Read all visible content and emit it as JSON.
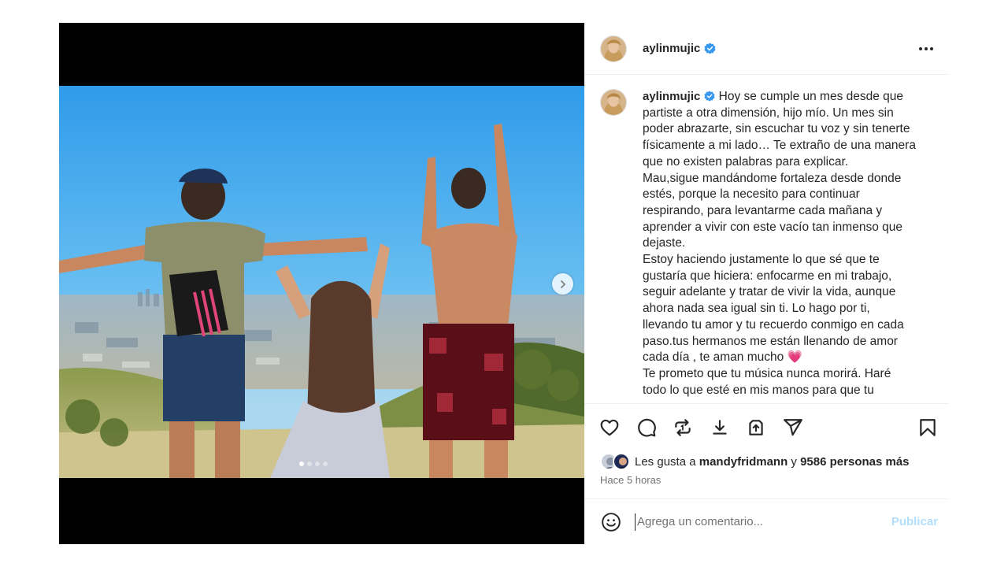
{
  "post": {
    "username": "aylinmujic",
    "verified": true,
    "media": {
      "slide_count": 4,
      "active_slide": 1,
      "next_icon": "chevron-right-icon"
    },
    "caption": {
      "lines": [
        "Hoy se cumple un mes desde que",
        "partiste a otra dimensión, hijo mío. Un mes sin",
        "poder abrazarte, sin escuchar tu voz y sin tenerte",
        "físicamente a mi lado… Te extraño de una manera",
        "que no existen palabras para explicar.",
        "Mau,sigue mandándome fortaleza desde donde",
        "estés, porque la necesito para continuar",
        "respirando, para levantarme cada mañana y",
        "aprender a vivir con este vacío tan inmenso que",
        "dejaste.",
        "Estoy haciendo justamente lo que sé que te",
        "gustaría que hiciera: enfocarme en mi trabajo,",
        "seguir adelante y tratar de vivir la vida, aunque",
        "ahora nada sea igual sin ti. Lo hago por ti,",
        "llevando tu amor y tu recuerdo conmigo en cada",
        "paso.tus hermanos me están llenando de amor",
        "cada día , te aman mucho",
        "Te prometo que tu música nunca morirá. Haré",
        "todo lo que esté en mis manos para que tu"
      ],
      "heart_emoji": "💗"
    },
    "actions": {
      "like_icon": "heart-icon",
      "comment_icon": "comment-bubble-icon",
      "repost_icon": "repost-icon",
      "download_icon": "download-icon",
      "share_icon": "share-icon",
      "send_icon": "send-icon",
      "save_icon": "bookmark-icon"
    },
    "likes": {
      "prefix": "Les gusta a",
      "first_user": "mandyfridmann",
      "connector": "y",
      "others": "9586 personas más"
    },
    "timestamp": "Hace 5 horas",
    "comment": {
      "placeholder": "Agrega un comentario...",
      "publish_label": "Publicar",
      "emoji_icon": "smiley-icon"
    }
  },
  "colors": {
    "accent_verified": "#3897f0",
    "publish_disabled": "#b2dffc",
    "text_primary": "#262626",
    "text_secondary": "#737373",
    "border": "#efefef"
  }
}
